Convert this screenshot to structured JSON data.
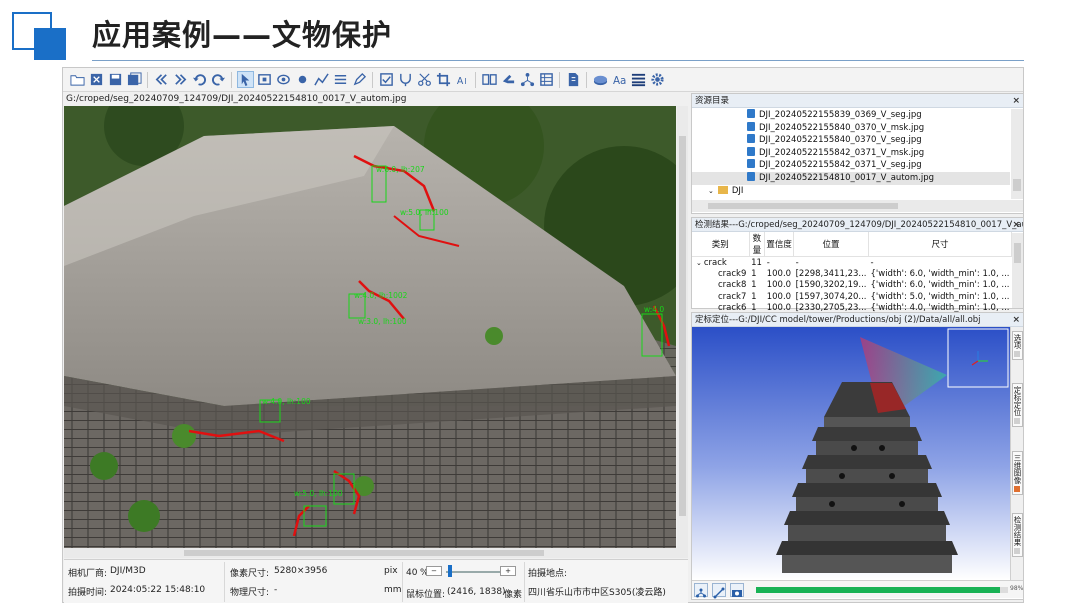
{
  "slide": {
    "title": "应用案例——文物保护",
    "colors": {
      "accent": "#1a6fc7",
      "rule": "#7aa0c8"
    }
  },
  "toolbar": {
    "icons": [
      "folder-open-icon",
      "close-file-icon",
      "save-icon",
      "save-all-icon",
      "previous-icon",
      "next-icon",
      "undo-icon",
      "redo-icon",
      "pointer-icon",
      "rectangle-select-icon",
      "ellipse-icon",
      "point-icon",
      "polyline-icon",
      "text-list-icon",
      "pen-icon",
      "checkbox-icon",
      "fork-icon",
      "scissors-icon",
      "crop-icon",
      "ai-text-icon",
      "book-icon",
      "arrow-tool-icon",
      "network-icon",
      "table-icon",
      "export-icon",
      "disc-icon",
      "font-icon",
      "list-icon",
      "gear-icon"
    ],
    "active_icon": "pointer-icon"
  },
  "image_pane": {
    "path": "G:/croped/seg_20240709_124709/DJI_20240522154810_0017_V_autom.jpg",
    "detections": [
      {
        "label": "w:6.0, lh:207"
      },
      {
        "label": "w:5.0,  lh:100"
      },
      {
        "label": "w:4.0, lh:1002"
      },
      {
        "label": "w:3.0, lh:100"
      },
      {
        "label": "w:4.0, lh:100"
      },
      {
        "label": "w:5.0, lh:100"
      },
      {
        "label": "w:4.0"
      }
    ]
  },
  "status_bar": {
    "camera_vendor_label": "相机厂商:",
    "camera_vendor": "DJI/M3D",
    "capture_time_label": "拍摄时间:",
    "capture_time": "2024:05:22 15:48:10",
    "pixel_size_label": "像素尺寸:",
    "pixel_size": "5280×3956",
    "pixel_unit": "pix",
    "physical_size_label": "物理尺寸:",
    "physical_size": "-",
    "physical_unit": "mm",
    "zoom_value": "40",
    "zoom_unit": "%",
    "mouse_pos_label": "鼠标位置:",
    "mouse_pos": "(2416, 1838)",
    "mouse_unit": "像素",
    "location_label": "拍摄地点:",
    "location": "四川省乐山市市中区S305(凌云路)"
  },
  "resource_panel": {
    "title": "资源目录",
    "close": "×",
    "files": [
      "DJI_20240522155839_0369_V_seg.jpg",
      "DJI_20240522155840_0370_V_msk.jpg",
      "DJI_20240522155840_0370_V_seg.jpg",
      "DJI_20240522155842_0371_V_msk.jpg",
      "DJI_20240522155842_0371_V_seg.jpg",
      "DJI_20240522154810_0017_V_autom.jpg"
    ],
    "folder": "DJI"
  },
  "results_panel": {
    "title": "检测结果---G:/croped/seg_20240709_124709/DJI_20240522154810_0017_V_auto...",
    "close": "×",
    "columns": [
      "类别",
      "数量",
      "置信度",
      "位置",
      "尺寸"
    ],
    "group": {
      "name": "crack",
      "count": "11",
      "conf": "-",
      "pos": "-",
      "size": "-"
    },
    "rows": [
      {
        "name": "crack9",
        "count": "1",
        "conf": "100.0",
        "pos": "[2298,3411,23...",
        "size": "{'width': 6.0, 'width_min': 1.0, ..."
      },
      {
        "name": "crack8",
        "count": "1",
        "conf": "100.0",
        "pos": "[1590,3202,19...",
        "size": "{'width': 6.0, 'width_min': 1.0, ..."
      },
      {
        "name": "crack7",
        "count": "1",
        "conf": "100.0",
        "pos": "[1597,3074,20...",
        "size": "{'width': 5.0, 'width_min': 1.0, ..."
      },
      {
        "name": "crack6",
        "count": "1",
        "conf": "100.0",
        "pos": "[2330,2705,23...",
        "size": "{'width': 4.0, 'width_min': 1.0, ..."
      }
    ]
  },
  "viewer_panel": {
    "title": "定标定位---G:/DJI/CC model/tower/Productions/obj (2)/Data/all/all.obj",
    "close": "×",
    "side_tabs": [
      "选项",
      "定标定位",
      "三维图像",
      "检测结果"
    ],
    "progress_value": 0.97,
    "progress_label": "98%"
  }
}
